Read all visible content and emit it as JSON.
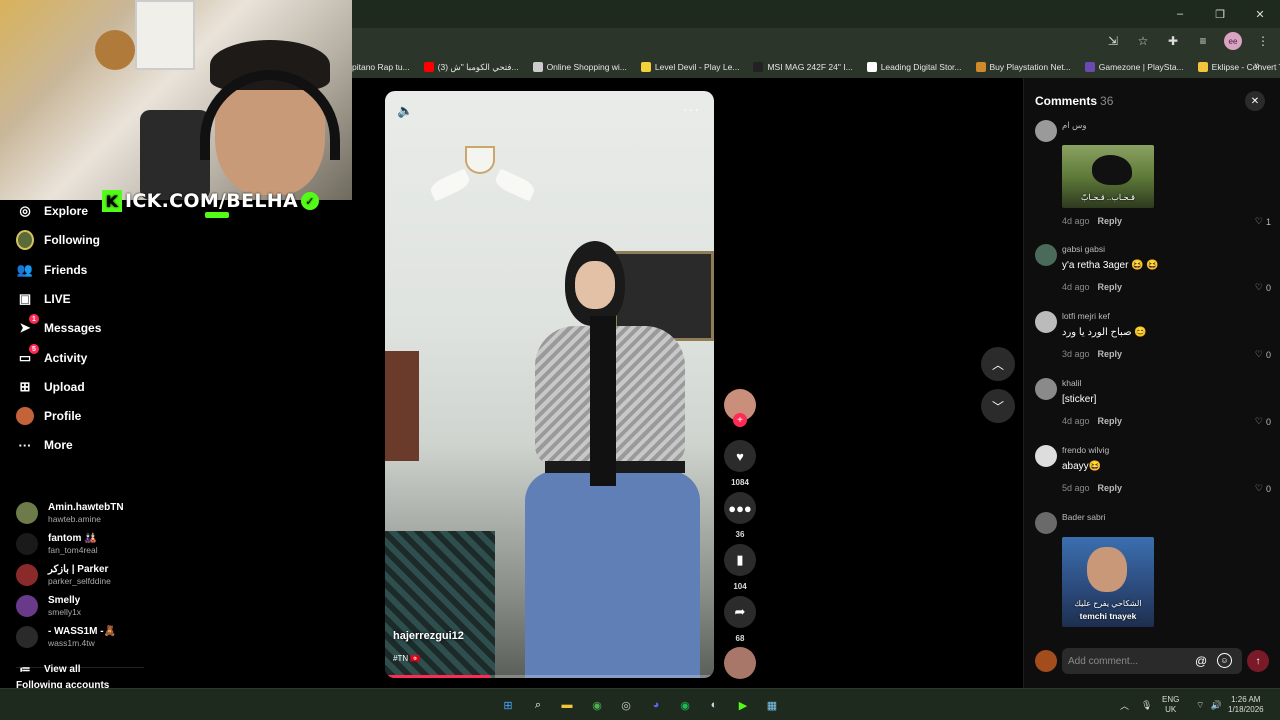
{
  "browser": {
    "bookmarks": [
      {
        "label": "pitano Rap tu...",
        "color": "#3a3a3a"
      },
      {
        "label": "(3) فتحي الكومبا \"ش...",
        "color": "#ff0000"
      },
      {
        "label": "Online Shopping wi...",
        "color": "#cccccc"
      },
      {
        "label": "Level Devil - Play Le...",
        "color": "#f2d13b"
      },
      {
        "label": "MSI MAG 242F 24\" I...",
        "color": "#222222"
      },
      {
        "label": "Leading Digital Stor...",
        "color": "#ffffff"
      },
      {
        "label": "Buy Playstation Net...",
        "color": "#d08a2a"
      },
      {
        "label": "Gamezone | PlaySta...",
        "color": "#6a4ab0"
      },
      {
        "label": "Eklipse - Convert Tw...",
        "color": "#f2c53b"
      }
    ],
    "more_bookmarks": "»",
    "window_controls": [
      "–",
      "❐",
      "✕"
    ],
    "profile_initials": "ee"
  },
  "stream_overlay": {
    "brand_text": "KICK.COM/BELHA",
    "brand_letter": "K",
    "verified": "✓"
  },
  "sidebar": {
    "nav": [
      {
        "label": "Explore",
        "icon": "compass-icon",
        "glyph": "◎"
      },
      {
        "label": "Following",
        "icon": "following-avatar-icon",
        "glyph": ""
      },
      {
        "label": "Friends",
        "icon": "friends-icon",
        "glyph": "👥"
      },
      {
        "label": "LIVE",
        "icon": "live-icon",
        "glyph": "▣"
      },
      {
        "label": "Messages",
        "icon": "messages-icon",
        "glyph": "➤",
        "badge": "1"
      },
      {
        "label": "Activity",
        "icon": "activity-icon",
        "glyph": "▭",
        "badge": "5"
      },
      {
        "label": "Upload",
        "icon": "upload-icon",
        "glyph": "⊞"
      },
      {
        "label": "Profile",
        "icon": "profile-icon",
        "glyph": ""
      },
      {
        "label": "More",
        "icon": "more-icon",
        "glyph": "···"
      }
    ],
    "following_title": "Following accounts",
    "accounts": [
      {
        "name": "Amin.hawtebTN",
        "handle": "hawteb.amine",
        "color": "#6d7a4a"
      },
      {
        "name": "fantom 🎎",
        "handle": "fan_tom4real",
        "color": "#1a1a1a"
      },
      {
        "name": "بازكر | Parker",
        "handle": "parker_selfddine",
        "color": "#8a2a2a"
      },
      {
        "name": "Smelly",
        "handle": "smelly1x",
        "color": "#6a3a8a"
      },
      {
        "name": "- WASS1M -🧸",
        "handle": "wass1m.4tw",
        "color": "#2a2a2a"
      }
    ],
    "view_all": "View all"
  },
  "video": {
    "author": "hajerrezgui12",
    "tags": "#TN 🇹🇳",
    "progress": 0.32,
    "mute_icon": "🔈",
    "more_icon": "···"
  },
  "actions": {
    "likes": "1084",
    "comments": "36",
    "saves": "104",
    "shares": "68"
  },
  "comments": {
    "title": "Comments",
    "count": "36",
    "close": "✕",
    "items": [
      {
        "user": "وس ام",
        "text": "",
        "time": "4d ago",
        "reply": "Reply",
        "likes": "1",
        "avatar": "#9a9a9a",
        "image": "crow",
        "image_caption": "قـحـاب.. قـحـابّ"
      },
      {
        "user": "gabsi gabsi",
        "text": "y'a retha 3ager 😆 😆",
        "time": "4d ago",
        "reply": "Reply",
        "likes": "0",
        "avatar": "#4a6a5a"
      },
      {
        "user": "lotfi mejri kef",
        "text": "صباح الورد يا ورد 😊",
        "time": "3d ago",
        "reply": "Reply",
        "likes": "0",
        "avatar": "#bbbbbb"
      },
      {
        "user": "khalil",
        "text": "[sticker]",
        "time": "4d ago",
        "reply": "Reply",
        "likes": "0",
        "avatar": "#8a8a8a"
      },
      {
        "user": "frendo wilvig",
        "text": "abayy😆",
        "time": "5d ago",
        "reply": "Reply",
        "likes": "0",
        "avatar": "#dddddd"
      },
      {
        "user": "Bader sabri",
        "text": "",
        "time": "",
        "reply": "",
        "likes": "",
        "avatar": "#6a6a6a",
        "image": "man",
        "image_caption": "الشكاحي يفرح عليك",
        "image_caption2": "temchi tnayek"
      }
    ],
    "input_placeholder": "Add comment...",
    "at_icon": "@",
    "emoji_icon": "☺",
    "send_icon": "↑"
  },
  "taskbar": {
    "language": "ENG",
    "region": "UK",
    "time": "1:26 AM",
    "date": "1/18/2026",
    "apps": [
      {
        "name": "start-icon",
        "glyph": "⊞",
        "color": "#4aa3ff"
      },
      {
        "name": "search-icon",
        "glyph": "⌕",
        "color": "#ffffff"
      },
      {
        "name": "file-explorer-icon",
        "glyph": "▬",
        "color": "#f2c53b"
      },
      {
        "name": "chrome-icon",
        "glyph": "◉",
        "color": "#4caf50"
      },
      {
        "name": "obs-icon",
        "glyph": "◎",
        "color": "#cccccc"
      },
      {
        "name": "discord-icon",
        "glyph": "◕",
        "color": "#5865f2"
      },
      {
        "name": "spotify-icon",
        "glyph": "◉",
        "color": "#1db954"
      },
      {
        "name": "steam-icon",
        "glyph": "◐",
        "color": "#c7d5e0"
      },
      {
        "name": "kick-app-icon",
        "glyph": "▶",
        "color": "#53fc18"
      },
      {
        "name": "photos-icon",
        "glyph": "▦",
        "color": "#7ec8f2"
      }
    ]
  }
}
